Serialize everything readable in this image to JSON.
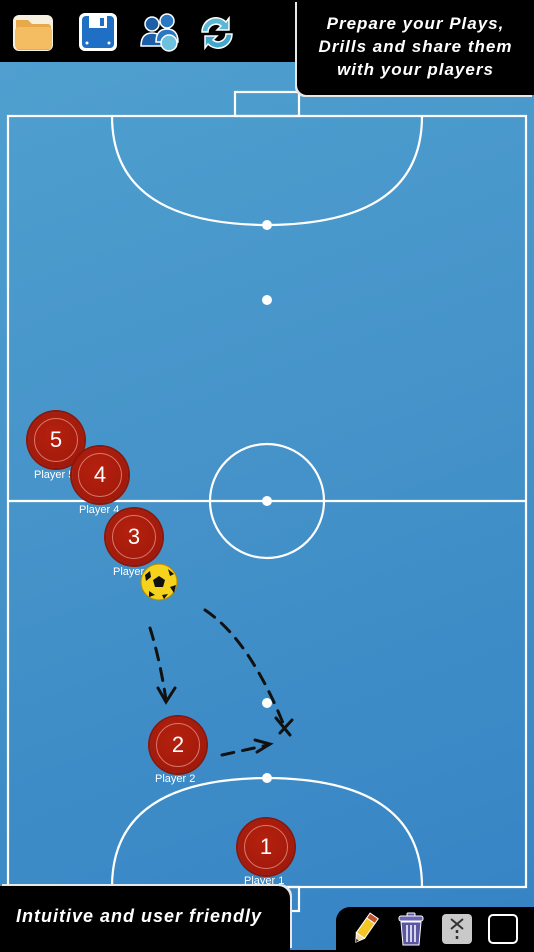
{
  "toolbar": {
    "buttons": [
      {
        "name": "open-folder",
        "icon": "folder-icon"
      },
      {
        "name": "save",
        "icon": "floppy-disk-icon"
      },
      {
        "name": "share-with-players",
        "icon": "users-share-icon"
      },
      {
        "name": "refresh",
        "icon": "sync-arrows-icon"
      }
    ]
  },
  "promo": {
    "top_lines": [
      "Prepare your Plays,",
      "Drills and share them",
      "with your players"
    ],
    "bottom": "Intuitive and user friendly"
  },
  "court": {
    "line_color": "#ffffff",
    "background": "#4593c9"
  },
  "players": [
    {
      "number": "5",
      "label": "Player 5"
    },
    {
      "number": "4",
      "label": "Player 4"
    },
    {
      "number": "3",
      "label": "Player 3"
    },
    {
      "number": "2",
      "label": "Player 2"
    },
    {
      "number": "1",
      "label": "Player 1"
    }
  ],
  "ball": {
    "icon": "soccer-ball-icon"
  },
  "tools": [
    {
      "name": "pencil",
      "icon": "pencil-icon"
    },
    {
      "name": "trash",
      "icon": "trash-icon"
    },
    {
      "name": "dashed-line",
      "icon": "dashed-arrow-icon"
    },
    {
      "name": "shape",
      "icon": "square-icon"
    }
  ]
}
